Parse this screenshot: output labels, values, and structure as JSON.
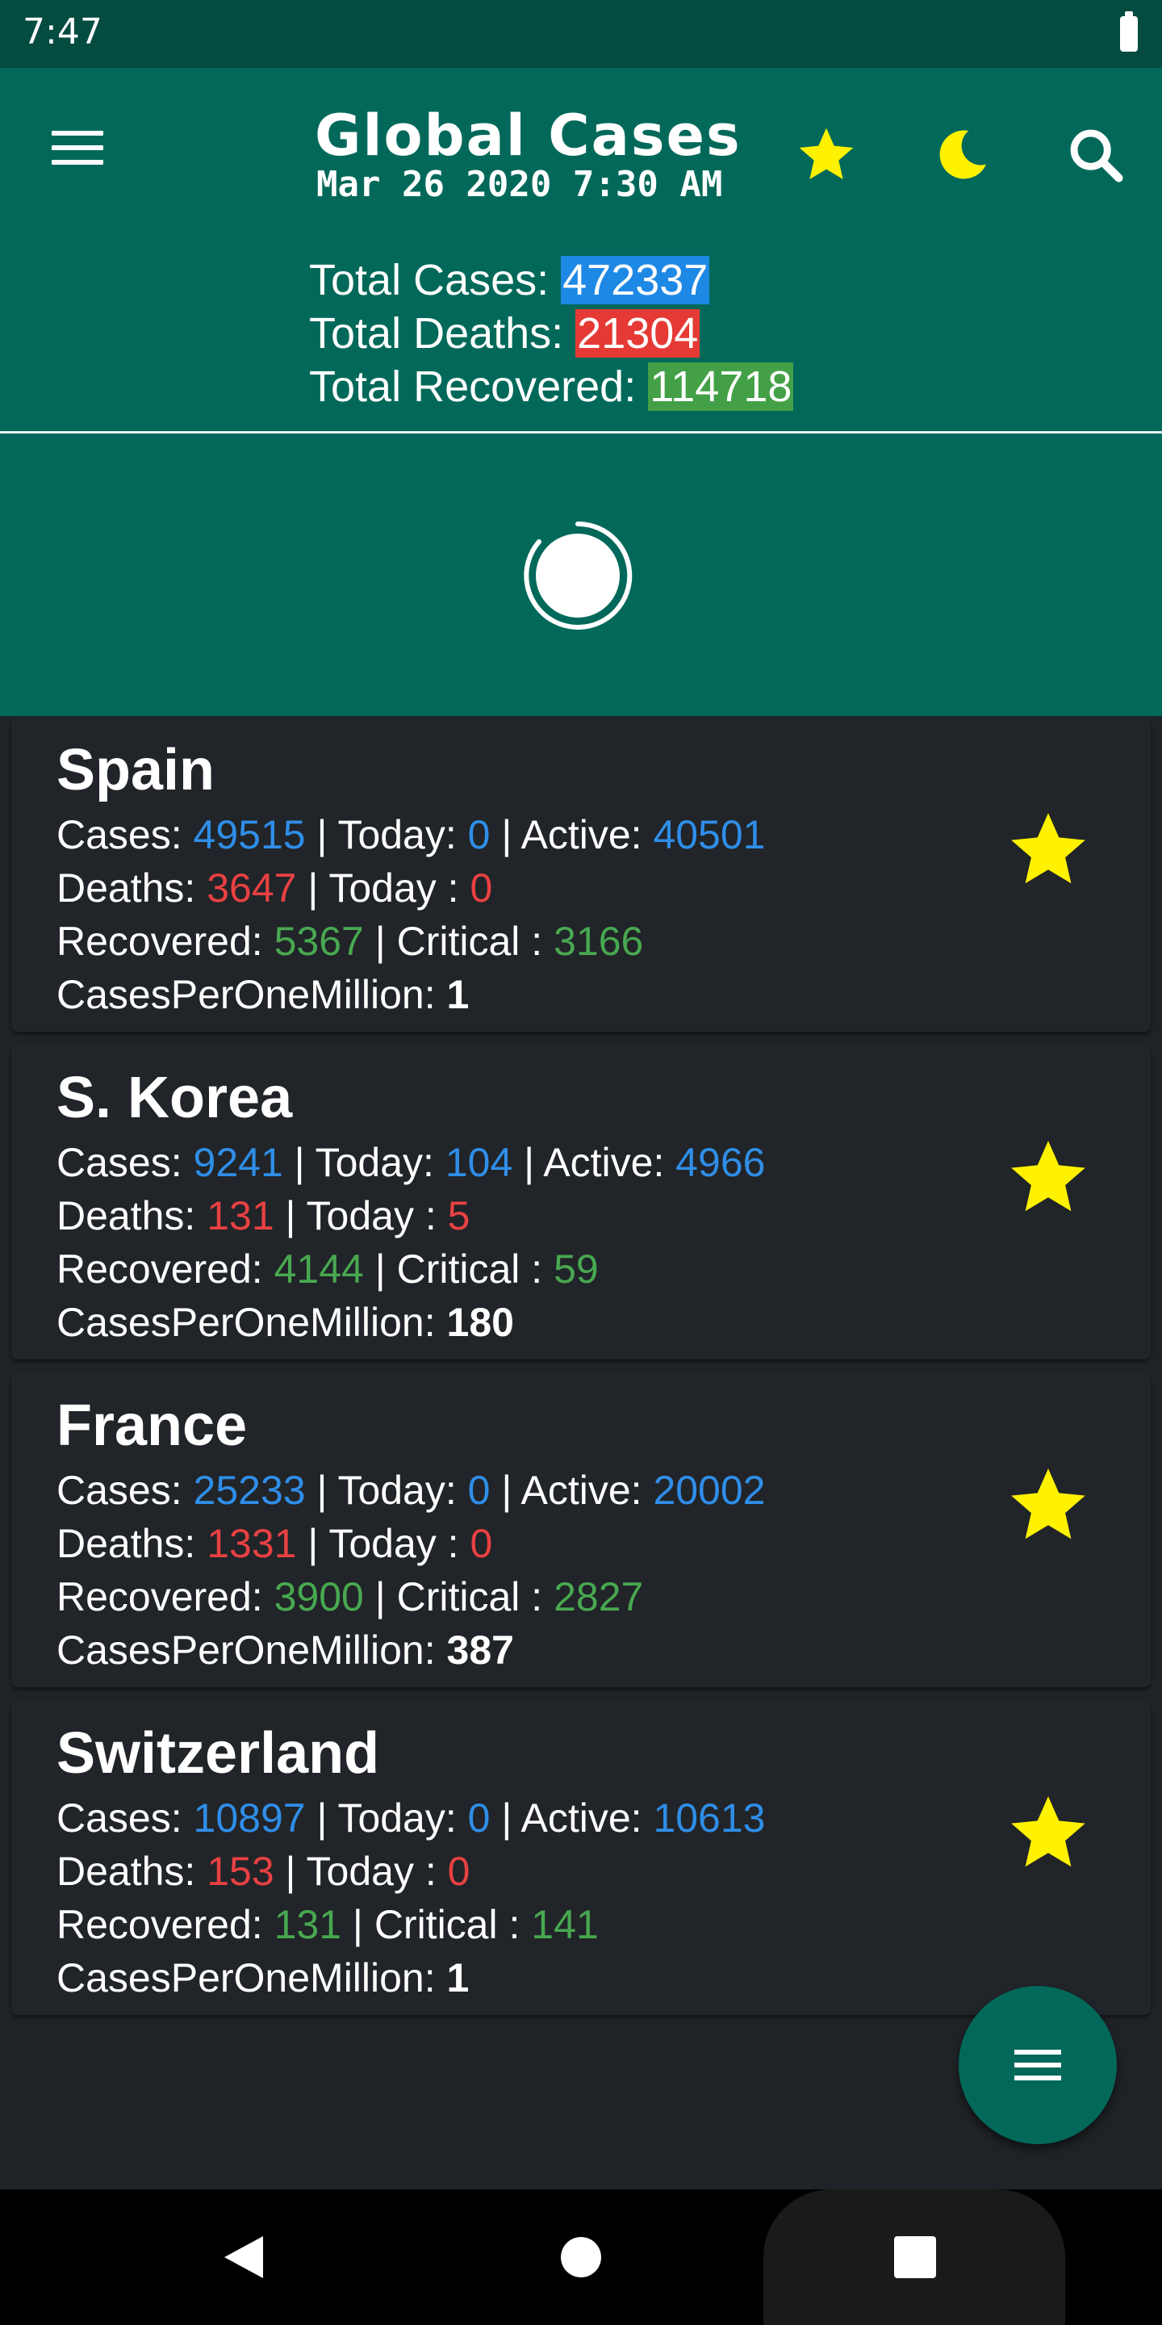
{
  "status_bar": {
    "time": "7:47",
    "battery_icon": "battery-full-icon"
  },
  "header": {
    "menu_icon": "hamburger-menu-icon",
    "title": "Global Cases",
    "subtitle": "Mar 26 2020 7:30 AM",
    "actions": {
      "favorites_icon": "star-icon",
      "dark_mode_icon": "moon-icon",
      "search_icon": "search-icon"
    },
    "totals": {
      "cases_label": "Total Cases: ",
      "cases_value": "472337",
      "deaths_label": "Total Deaths: ",
      "deaths_value": "21304",
      "recovered_label": "Total Recovered: ",
      "recovered_value": "114718"
    }
  },
  "loader": {
    "icon": "loading-spinner-icon"
  },
  "labels": {
    "cases": "Cases: ",
    "sep": " | ",
    "today": "Today: ",
    "active": "Active: ",
    "deaths": "Deaths: ",
    "today_deaths": "Today : ",
    "recovered": "Recovered: ",
    "critical": "Critical : ",
    "per_million": "CasesPerOneMillion: "
  },
  "countries": [
    {
      "name": "Spain",
      "cases": "49515",
      "today_cases": "0",
      "active": "40501",
      "deaths": "3647",
      "today_deaths": "0",
      "recovered": "5367",
      "critical": "3166",
      "per_million": "1",
      "favorite_icon": "star-icon"
    },
    {
      "name": "S. Korea",
      "cases": "9241",
      "today_cases": "104",
      "active": "4966",
      "deaths": "131",
      "today_deaths": "5",
      "recovered": "4144",
      "critical": "59",
      "per_million": "180",
      "favorite_icon": "star-icon"
    },
    {
      "name": "France",
      "cases": "25233",
      "today_cases": "0",
      "active": "20002",
      "deaths": "1331",
      "today_deaths": "0",
      "recovered": "3900",
      "critical": "2827",
      "per_million": "387",
      "favorite_icon": "star-icon"
    },
    {
      "name": "Switzerland",
      "cases": "10897",
      "today_cases": "0",
      "active": "10613",
      "deaths": "153",
      "today_deaths": "0",
      "recovered": "131",
      "critical": "141",
      "per_million": "1",
      "favorite_icon": "star-icon"
    }
  ],
  "fab": {
    "icon": "menu-icon"
  },
  "nav_bar": {
    "back_icon": "back-triangle-icon",
    "home_icon": "home-circle-icon",
    "recents_icon": "recents-square-icon"
  },
  "colors": {
    "primary": "#02695a",
    "status_bar": "#044b40",
    "background": "#1f2226",
    "cases": "#2f8ee8",
    "deaths": "#e84142",
    "recovered": "#48a850",
    "star": "#fff200"
  }
}
